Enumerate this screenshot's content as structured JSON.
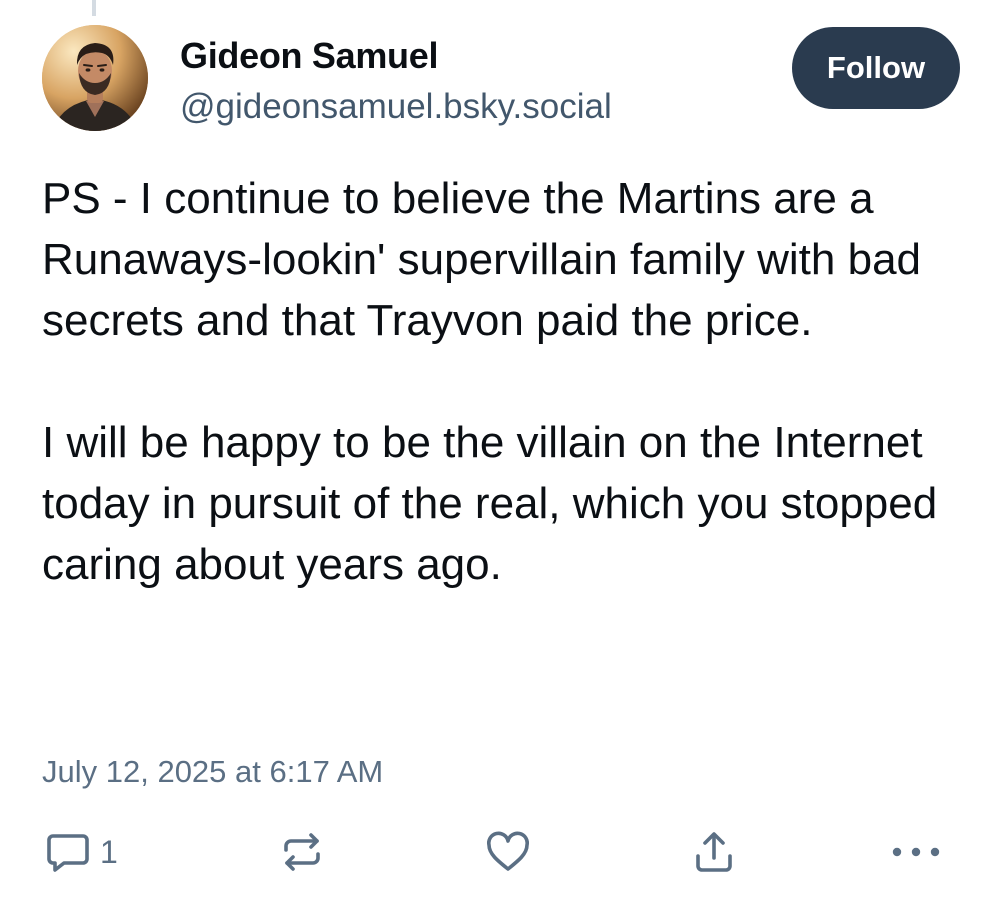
{
  "post": {
    "author": {
      "display_name": "Gideon Samuel",
      "handle": "@gideonsamuel.bsky.social",
      "avatar_icon": "profile-photo"
    },
    "follow_label": "Follow",
    "paragraphs": [
      "PS - I continue to believe the Martins are a Runaways-lookin' supervillain family with bad secrets and that Trayvon paid the price.",
      "I will be happy to be the villain on the Internet today in pursuit of the real, which you stopped caring about years ago."
    ],
    "timestamp": "July 12, 2025 at 6:17 AM",
    "actions": {
      "reply_count": "1",
      "reply_icon": "reply-bubble-icon",
      "repost_icon": "repost-icon",
      "like_icon": "heart-icon",
      "share_icon": "share-icon",
      "more_icon": "more-dots-icon"
    }
  },
  "colors": {
    "text_primary": "#0b0f14",
    "text_secondary": "#5b6f84",
    "follow_button_bg": "#2a3b4f",
    "follow_button_text": "#ffffff",
    "icon": "#5b6f84"
  }
}
